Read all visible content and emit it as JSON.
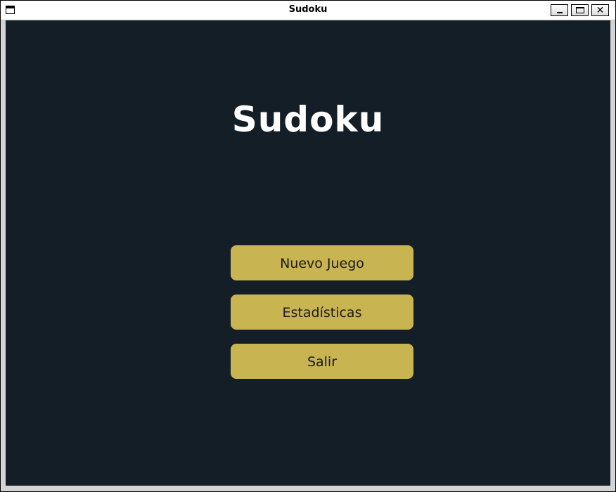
{
  "window": {
    "title": "Sudoku",
    "controls": {
      "minimize": "_",
      "maximize": "□",
      "close": "✕"
    }
  },
  "main": {
    "title": "Sudoku",
    "menu": [
      {
        "label": "Nuevo Juego"
      },
      {
        "label": "Estadísticas"
      },
      {
        "label": "Salir"
      }
    ]
  },
  "colors": {
    "background": "#141e27",
    "button": "#c8b451",
    "title_text": "#ffffff"
  }
}
